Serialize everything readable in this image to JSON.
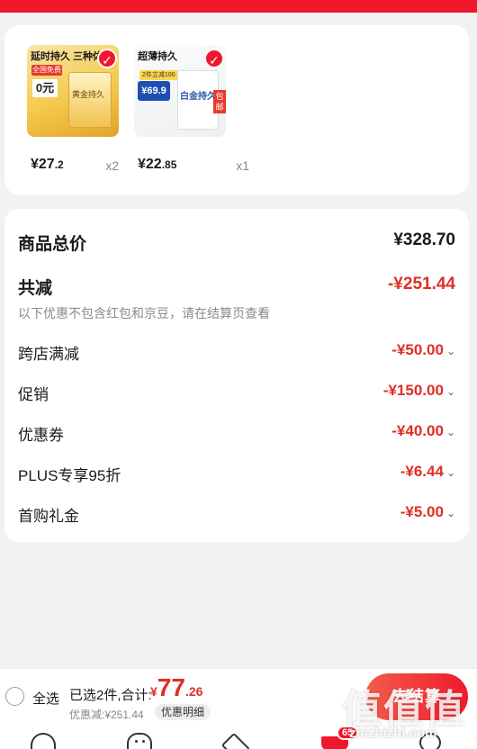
{
  "products": [
    {
      "banner": "延时持久 三种体验",
      "badge": "全国免费",
      "zero_tag": "0元",
      "box_text": "黄金持久",
      "price_int": "¥27",
      "price_dec": ".2",
      "qty": "x2"
    },
    {
      "banner": "超薄持久",
      "promo_pill": "2件立减100",
      "price_tag": "¥69.9",
      "box_text": "白金持久",
      "side_tag": "包邮",
      "price_int": "¥22",
      "price_dec": ".85",
      "qty": "x1"
    }
  ],
  "summary": {
    "total_label": "商品总价",
    "total_value": "¥328.70",
    "reduce_label": "共减",
    "reduce_value": "-¥251.44",
    "note": "以下优惠不包含红包和京豆，请在结算页查看",
    "items": [
      {
        "label": "跨店满减",
        "value": "-¥50.00"
      },
      {
        "label": "促销",
        "value": "-¥150.00"
      },
      {
        "label": "优惠券",
        "value": "-¥40.00"
      },
      {
        "label": "PLUS专享95折",
        "value": "-¥6.44"
      },
      {
        "label": "首购礼金",
        "value": "-¥5.00"
      }
    ]
  },
  "bottom_bar": {
    "select_all": "全选",
    "selected_text": "已选2件,合计:",
    "total_currency": "¥",
    "total_int": "77",
    "total_dec": ".26",
    "discount_text": "优惠减:¥251.44",
    "detail_chip": "优惠明细",
    "checkout_label": "去结算"
  },
  "tab_bar": {
    "cart_badge": "65"
  },
  "watermark": {
    "glyphs": "值值值",
    "url": "zhizhizhi.com"
  },
  "colors": {
    "brand_red": "#f0162c",
    "price_red": "#e02e24"
  },
  "icons": [
    "check-icon",
    "chevron-down-icon",
    "home-icon",
    "discover-icon",
    "box-icon",
    "cart-icon",
    "profile-icon"
  ]
}
